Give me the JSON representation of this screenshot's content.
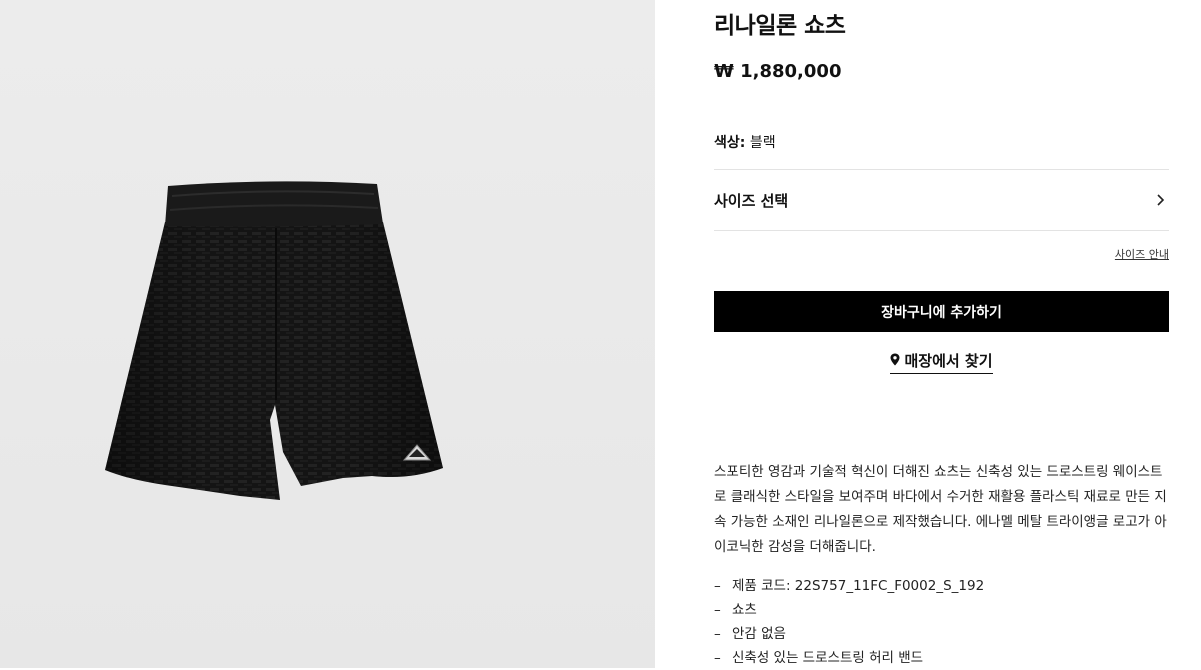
{
  "product": {
    "title": "리나일론 쇼츠",
    "price": "₩ 1,880,000",
    "color_label": "색상:",
    "color_value": "블랙",
    "size_select_label": "사이즈 선택",
    "size_guide_label": "사이즈 안내",
    "add_to_cart_label": "장바구니에 추가하기",
    "find_store_label": "매장에서 찾기",
    "description": "스포티한 영감과 기술적 혁신이 더해진 쇼츠는 신축성 있는 드로스트링 웨이스트로 클래식한 스타일을 보여주며 바다에서 수거한 재활용 플라스틱 재료로 만든 지속 가능한 소재인 리나일론으로 제작했습니다. 에나멜 메탈 트라이앵글 로고가 아이코닉한 감성을 더해줍니다.",
    "specs": [
      "제품 코드: 22S757_11FC_F0002_S_192",
      "쇼츠",
      "안감 없음",
      "신축성 있는 드로스트링 허리 밴드"
    ]
  },
  "icons": {
    "chevron": "chevron-right-icon",
    "location": "map-pin-icon"
  },
  "colors": {
    "button_bg": "#000000",
    "image_bg": "#e9e9e9"
  }
}
